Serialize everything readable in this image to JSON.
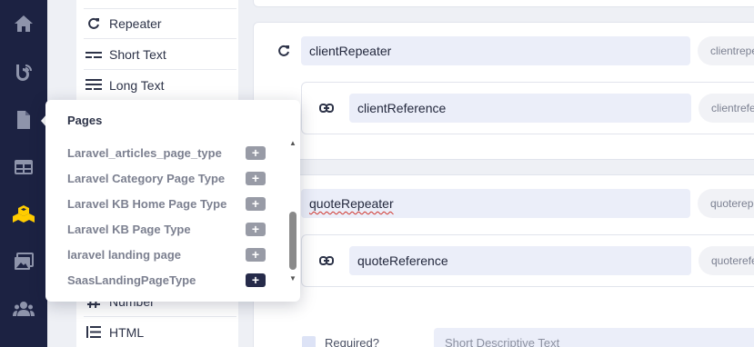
{
  "rail": {
    "icons": [
      "home-icon",
      "blog-icon",
      "page-icon",
      "table-icon",
      "components-icon",
      "media-icon",
      "users-icon"
    ],
    "active_color": "#ffcc00"
  },
  "field_types": {
    "items": [
      {
        "label": "Repeater",
        "icon": "repeater-icon"
      },
      {
        "label": "Short Text",
        "icon": "short-text-icon"
      },
      {
        "label": "Long Text",
        "icon": "long-text-icon"
      },
      {
        "label": "Number",
        "icon": "number-icon"
      },
      {
        "label": "HTML",
        "icon": "html-icon"
      }
    ]
  },
  "editor": {
    "client_repeater": {
      "name": "clientRepeater",
      "key": "clientrepeater"
    },
    "client_reference": {
      "name": "clientReference",
      "key": "clientreference"
    },
    "quote_repeater": {
      "name": "quoteRepeater",
      "key": "quoterepeater"
    },
    "quote_reference": {
      "name": "quoteReference",
      "key": "quotereference"
    },
    "required_label": "Required?",
    "description_placeholder": "Short Descriptive Text"
  },
  "popover": {
    "title": "Pages",
    "items": [
      {
        "label": "Laravel_articles_page_type"
      },
      {
        "label": "Laravel Category Page Type"
      },
      {
        "label": "Laravel KB Home Page Type"
      },
      {
        "label": "Laravel KB Page Type"
      },
      {
        "label": "laravel landing page"
      },
      {
        "label": "SaasLandingPageType"
      }
    ],
    "add_symbol": "+"
  }
}
